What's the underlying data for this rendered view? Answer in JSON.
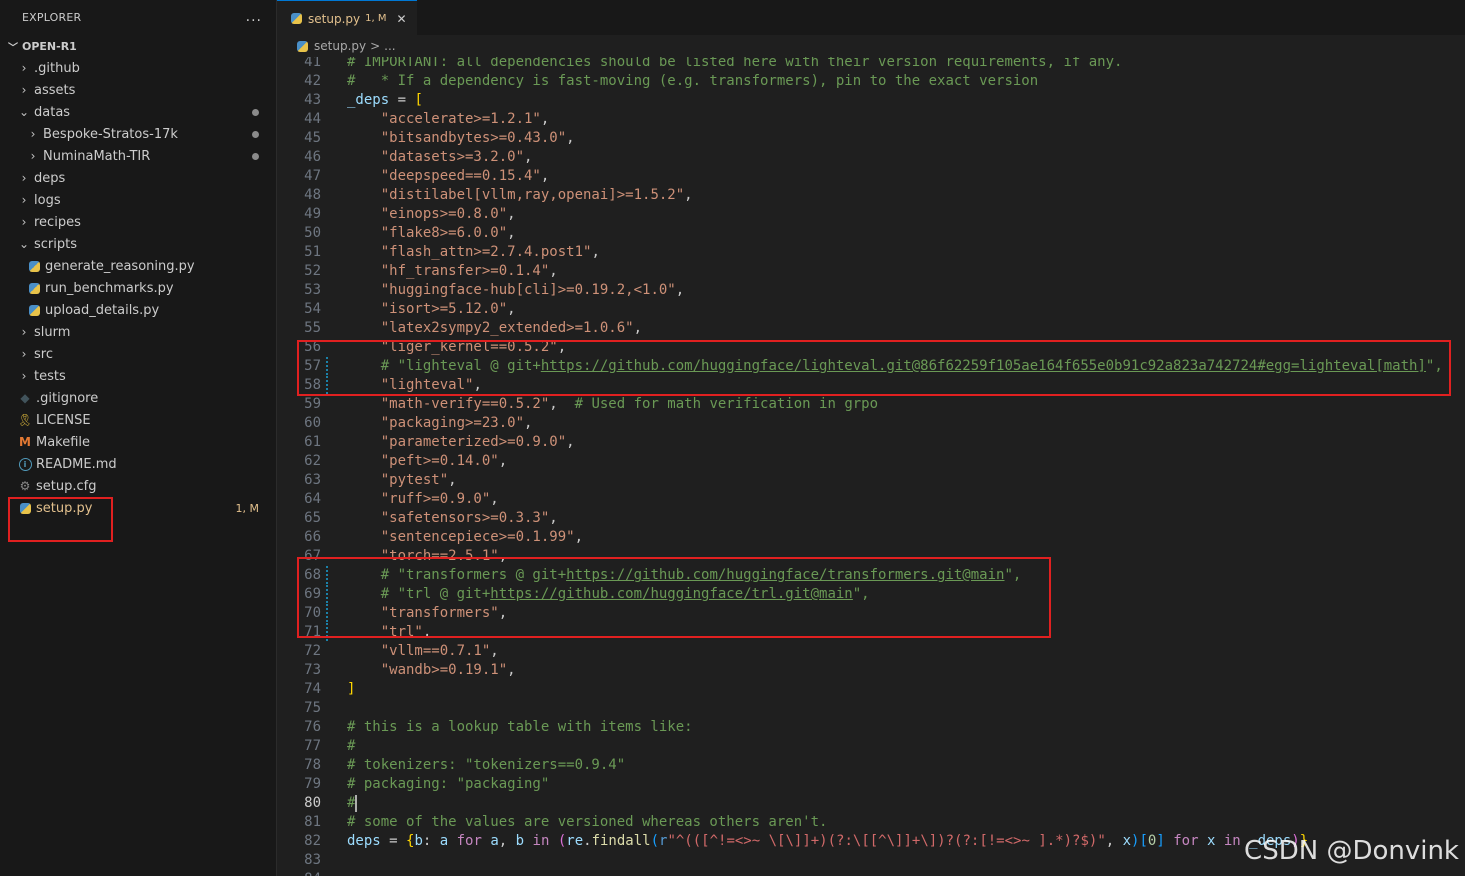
{
  "explorer": {
    "title": "EXPLORER",
    "more": "...",
    "root": "OPEN-R1",
    "items": [
      {
        "label": ".github",
        "kind": "folder"
      },
      {
        "label": "assets",
        "kind": "folder"
      },
      {
        "label": "datas",
        "kind": "folder-open"
      },
      {
        "label": "Bespoke-Stratos-17k",
        "kind": "folder"
      },
      {
        "label": "NuminaMath-TIR",
        "kind": "folder"
      },
      {
        "label": "deps",
        "kind": "folder"
      },
      {
        "label": "logs",
        "kind": "folder"
      },
      {
        "label": "recipes",
        "kind": "folder"
      },
      {
        "label": "scripts",
        "kind": "folder-open"
      },
      {
        "label": "generate_reasoning.py",
        "kind": "python"
      },
      {
        "label": "run_benchmarks.py",
        "kind": "python"
      },
      {
        "label": "upload_details.py",
        "kind": "python"
      },
      {
        "label": "slurm",
        "kind": "folder"
      },
      {
        "label": "src",
        "kind": "folder"
      },
      {
        "label": "tests",
        "kind": "folder"
      },
      {
        "label": ".gitignore",
        "kind": "git"
      },
      {
        "label": "LICENSE",
        "kind": "license"
      },
      {
        "label": "Makefile",
        "kind": "makefile"
      },
      {
        "label": "README.md",
        "kind": "info"
      },
      {
        "label": "setup.cfg",
        "kind": "gear"
      },
      {
        "label": "setup.py",
        "kind": "python",
        "badge": "1, M"
      }
    ]
  },
  "tab": {
    "name": "setup.py",
    "badge": "1, M",
    "close": "✕"
  },
  "breadcrumb": {
    "file": "setup.py",
    "sep": ">",
    "more": "..."
  },
  "editor": {
    "active_line": 80,
    "lines": [
      {
        "n": "41",
        "t": "# IMPORTANT: all dependencies should be listed here with their version requirements, if any."
      },
      {
        "n": "42",
        "t": "#   * If a dependency is fast-moving (e.g. transformers), pin to the exact version"
      },
      {
        "n": "43",
        "t": "_deps = ["
      },
      {
        "n": "44",
        "t": "    \"accelerate>=1.2.1\","
      },
      {
        "n": "45",
        "t": "    \"bitsandbytes>=0.43.0\","
      },
      {
        "n": "46",
        "t": "    \"datasets>=3.2.0\","
      },
      {
        "n": "47",
        "t": "    \"deepspeed==0.15.4\","
      },
      {
        "n": "48",
        "t": "    \"distilabel[vllm,ray,openai]>=1.5.2\","
      },
      {
        "n": "49",
        "t": "    \"einops>=0.8.0\","
      },
      {
        "n": "50",
        "t": "    \"flake8>=6.0.0\","
      },
      {
        "n": "51",
        "t": "    \"flash_attn>=2.7.4.post1\","
      },
      {
        "n": "52",
        "t": "    \"hf_transfer>=0.1.4\","
      },
      {
        "n": "53",
        "t": "    \"huggingface-hub[cli]>=0.19.2,<1.0\","
      },
      {
        "n": "54",
        "t": "    \"isort>=5.12.0\","
      },
      {
        "n": "55",
        "t": "    \"latex2sympy2_extended>=1.0.6\","
      },
      {
        "n": "56",
        "t": "    \"liger_kernel==0.5.2\","
      },
      {
        "n": "57",
        "t": "    # \"lighteval @ git+https://github.com/huggingface/lighteval.git@86f62259f105ae164f655e0b91c92a823a742724#egg=lighteval[math]\","
      },
      {
        "n": "58",
        "t": "    \"lighteval\","
      },
      {
        "n": "59",
        "t": "    \"math-verify==0.5.2\",  # Used for math verification in grpo"
      },
      {
        "n": "60",
        "t": "    \"packaging>=23.0\","
      },
      {
        "n": "61",
        "t": "    \"parameterized>=0.9.0\","
      },
      {
        "n": "62",
        "t": "    \"peft>=0.14.0\","
      },
      {
        "n": "63",
        "t": "    \"pytest\","
      },
      {
        "n": "64",
        "t": "    \"ruff>=0.9.0\","
      },
      {
        "n": "65",
        "t": "    \"safetensors>=0.3.3\","
      },
      {
        "n": "66",
        "t": "    \"sentencepiece>=0.1.99\","
      },
      {
        "n": "67",
        "t": "    \"torch==2.5.1\","
      },
      {
        "n": "68",
        "t": "    # \"transformers @ git+https://github.com/huggingface/transformers.git@main\","
      },
      {
        "n": "69",
        "t": "    # \"trl @ git+https://github.com/huggingface/trl.git@main\","
      },
      {
        "n": "70",
        "t": "    \"transformers\","
      },
      {
        "n": "71",
        "t": "    \"trl\","
      },
      {
        "n": "72",
        "t": "    \"vllm==0.7.1\","
      },
      {
        "n": "73",
        "t": "    \"wandb>=0.19.1\","
      },
      {
        "n": "74",
        "t": "]"
      },
      {
        "n": "75",
        "t": ""
      },
      {
        "n": "76",
        "t": "# this is a lookup table with items like:"
      },
      {
        "n": "77",
        "t": "#"
      },
      {
        "n": "78",
        "t": "# tokenizers: \"tokenizers==0.9.4\""
      },
      {
        "n": "79",
        "t": "# packaging: \"packaging\""
      },
      {
        "n": "80",
        "t": "#"
      },
      {
        "n": "81",
        "t": "# some of the values are versioned whereas others aren't."
      },
      {
        "n": "82",
        "t": "deps = {b: a for a, b in (re.findall(r\"^(([^!=<>~ \\[\\]]+)(?:\\[[^\\]]+\\])?(?:[!=<>~ ].*)?$)\", x)[0] for x in _deps)}"
      },
      {
        "n": "83",
        "t": ""
      },
      {
        "n": "84",
        "t": ""
      }
    ]
  },
  "watermark": "CSDN @Donvink",
  "colors": {
    "background": "#1f1f1f",
    "sidebar": "#181818",
    "string": "#ce9178",
    "comment": "#6a9955",
    "keyword": "#c586c0",
    "highlight_box": "#e02020",
    "modified": "#e2c08d"
  }
}
